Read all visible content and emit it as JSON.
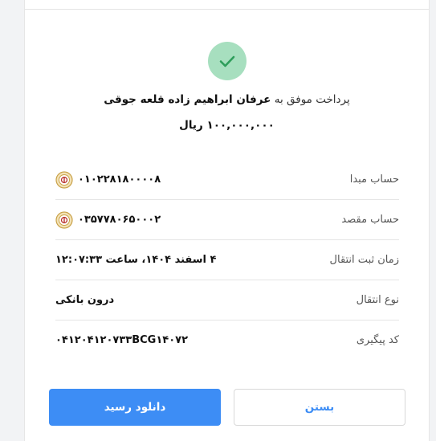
{
  "receipt": {
    "title_prefix": "پرداخت موفق به",
    "recipient": "عرفان ابراهیم زاده قلعه جوقی",
    "amount": "۱۰۰,۰۰۰,۰۰۰ ریال"
  },
  "rows": [
    {
      "label": "حساب مبدا",
      "value": "۰۱۰۲۲۸۱۸۰۰۰۰۸",
      "icon": "bank-logo-icon"
    },
    {
      "label": "حساب مقصد",
      "value": "۰۳۵۷۷۸۰۶۵۰۰۰۲",
      "icon": "bank-logo-icon"
    },
    {
      "label": "زمان ثبت انتقال",
      "value": "۴ اسفند ۱۴۰۴، ساعت ۱۲:۰۷:۳۳"
    },
    {
      "label": "نوع انتقال",
      "value": "درون بانکی"
    },
    {
      "label": "کد پیگیری",
      "value": "۰۴۱۲۰۴۱۲۰۷۳۳BCG۱۴۰۷۲"
    }
  ],
  "buttons": {
    "download": "دانلود رسید",
    "close": "بستن"
  },
  "colors": {
    "accent": "#3d8df5",
    "success_bg": "#a7dfbf",
    "success_check": "#2e9e5b"
  }
}
